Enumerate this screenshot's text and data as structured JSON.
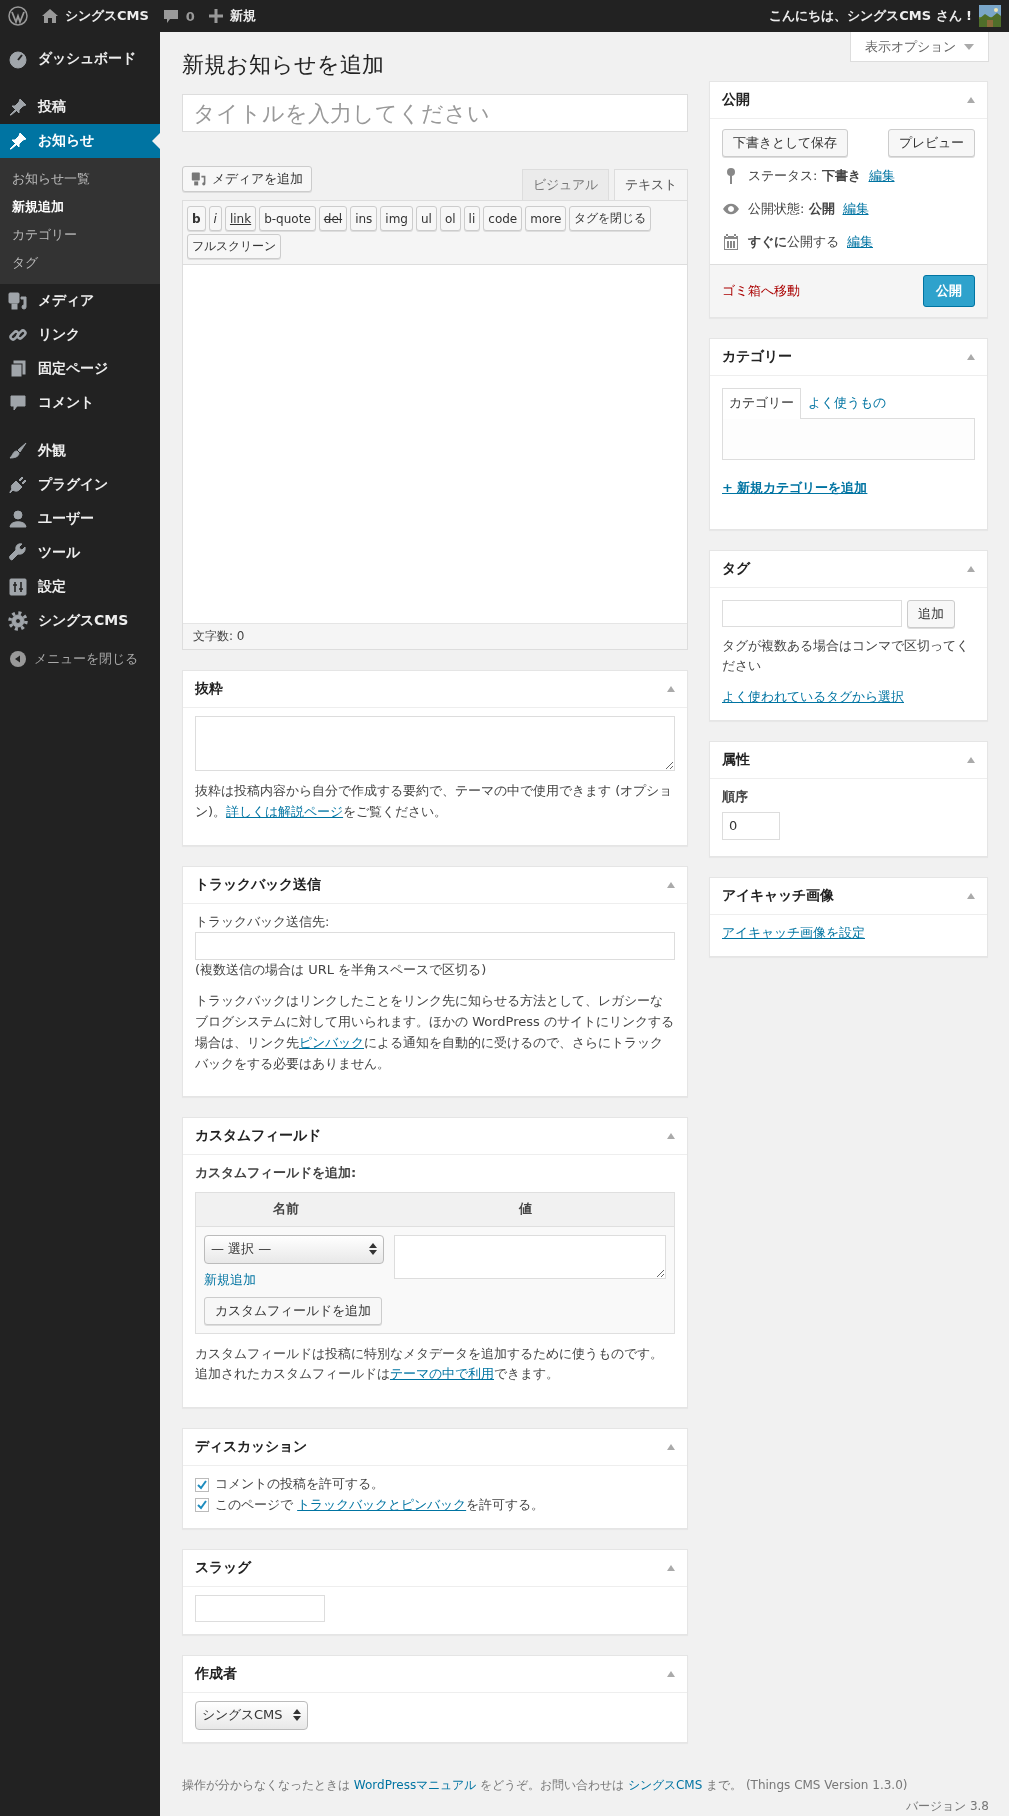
{
  "admin_bar": {
    "site_name": "シングスCMS",
    "comments": "0",
    "new": "新規",
    "greeting": "こんにちは、シングスCMS さん !"
  },
  "menu": {
    "groups": [
      {
        "items": [
          {
            "label": "ダッシュボード",
            "selected": false
          }
        ]
      },
      {
        "items": [
          {
            "label": "投稿",
            "selected": false
          },
          {
            "label": "お知らせ",
            "selected": true,
            "children": [
              {
                "label": "お知らせ一覧",
                "selected": false
              },
              {
                "label": "新規追加",
                "selected": true
              },
              {
                "label": "カテゴリー",
                "selected": false
              },
              {
                "label": "タグ",
                "selected": false
              }
            ]
          },
          {
            "label": "メディア",
            "selected": false
          },
          {
            "label": "リンク",
            "selected": false
          },
          {
            "label": "固定ページ",
            "selected": false
          },
          {
            "label": "コメント",
            "selected": false
          }
        ]
      },
      {
        "items": [
          {
            "label": "外観",
            "selected": false
          },
          {
            "label": "プラグイン",
            "selected": false
          },
          {
            "label": "ユーザー",
            "selected": false
          },
          {
            "label": "ツール",
            "selected": false
          },
          {
            "label": "設定",
            "selected": false
          },
          {
            "label": "シングスCMS",
            "selected": false
          }
        ]
      }
    ],
    "collapse": "メニューを閉じる"
  },
  "screen_options": "表示オプション",
  "page_title": "新規お知らせを追加",
  "title_field": {
    "placeholder": "タイトルを入力してください"
  },
  "editor": {
    "media_button": "メディアを追加",
    "tabs": [
      {
        "label": "ビジュアル",
        "selected": false
      },
      {
        "label": "テキスト",
        "selected": true
      }
    ],
    "quicktags": [
      {
        "label": "b",
        "kind": "bold"
      },
      {
        "label": "i",
        "kind": "italic"
      },
      {
        "label": "link",
        "kind": "link"
      },
      {
        "label": "b-quote",
        "kind": "plain"
      },
      {
        "label": "del",
        "kind": "strike"
      },
      {
        "label": "ins",
        "kind": "plain"
      },
      {
        "label": "img",
        "kind": "plain"
      },
      {
        "label": "ul",
        "kind": "plain"
      },
      {
        "label": "ol",
        "kind": "plain"
      },
      {
        "label": "li",
        "kind": "plain"
      },
      {
        "label": "code",
        "kind": "plain"
      },
      {
        "label": "more",
        "kind": "plain"
      },
      {
        "label": "タグを閉じる",
        "kind": "plain"
      },
      {
        "label": "フルスクリーン",
        "kind": "plain"
      }
    ],
    "word_count": "文字数: 0"
  },
  "main_boxes": [
    {
      "kind": "excerpt",
      "title": "抜粋",
      "description": {
        "before": "抜粋は投稿内容から自分で作成する要約で、テーマの中で使用できます (オプション)。",
        "link": "詳しくは解説ページ",
        "after": "をご覧ください。"
      }
    },
    {
      "kind": "trackbacks",
      "title": "トラックバック送信",
      "label": "トラックバック送信先:",
      "hint": "(複数送信の場合は URL を半角スペースで区切る)",
      "description": {
        "before": "トラックバックはリンクしたことをリンク先に知らせる方法として、レガシーなブログシステムに対して用いられます。ほかの WordPress のサイトにリンクする場合は、リンク先",
        "link": "ピンバック",
        "after": "による通知を自動的に受けるので、さらにトラックバックをする必要はありません。"
      }
    },
    {
      "kind": "custom_fields",
      "title": "カスタムフィールド",
      "subtitle": "カスタムフィールドを追加:",
      "columns": [
        "名前",
        "値"
      ],
      "select": "— 選択 —",
      "new_link": "新規追加",
      "add_button": "カスタムフィールドを追加",
      "description": {
        "before": "カスタムフィールドは投稿に特別なメタデータを追加するために使うものです。追加されたカスタムフィールドは",
        "link": "テーマの中で利用",
        "after": "できます。"
      }
    },
    {
      "kind": "discussion",
      "title": "ディスカッション",
      "options": [
        {
          "before": "コメントの投稿を許可する。",
          "checked": true
        },
        {
          "before": "このページで ",
          "link": "トラックバックとピンバック",
          "after": "を許可する。",
          "checked": true
        }
      ]
    },
    {
      "kind": "slug",
      "title": "スラッグ"
    },
    {
      "kind": "author",
      "title": "作成者",
      "value": "シングスCMS"
    }
  ],
  "side_boxes": [
    {
      "kind": "publish",
      "title": "公開",
      "save_draft": "下書きとして保存",
      "preview": "プレビュー",
      "rows": [
        {
          "kind": "status",
          "text": "ステータス: **下書き**",
          "link": "編集"
        },
        {
          "kind": "visibility",
          "text": "公開状態: **公開**",
          "link": "編集"
        },
        {
          "kind": "schedule",
          "text": "**すぐに**公開する",
          "link": "編集"
        }
      ],
      "trash": "ゴミ箱へ移動",
      "publish": "公開"
    },
    {
      "kind": "categories",
      "title": "カテゴリー",
      "tabs": [
        {
          "label": "カテゴリー",
          "selected": true
        },
        {
          "label": "よく使うもの",
          "selected": false
        }
      ],
      "add_link": "+ 新規カテゴリーを追加"
    },
    {
      "kind": "tags",
      "title": "タグ",
      "add_button": "追加",
      "hint": "タグが複数ある場合はコンマで区切ってください",
      "choose_link": "よく使われているタグから選択"
    },
    {
      "kind": "attributes",
      "title": "属性",
      "order_label": "順序",
      "order_value": "0"
    },
    {
      "kind": "thumbnail",
      "title": "アイキャッチ画像",
      "set_link": "アイキャッチ画像を設定"
    }
  ],
  "footer": {
    "before": "操作が分からなくなったときは ",
    "link1": "WordPressマニュアル",
    "middle": " をどうぞ。お問い合わせは ",
    "link2": "シングスCMS",
    "after": " まで。 (Things CMS Version 1.3.0)",
    "version": "バージョン 3.8"
  }
}
